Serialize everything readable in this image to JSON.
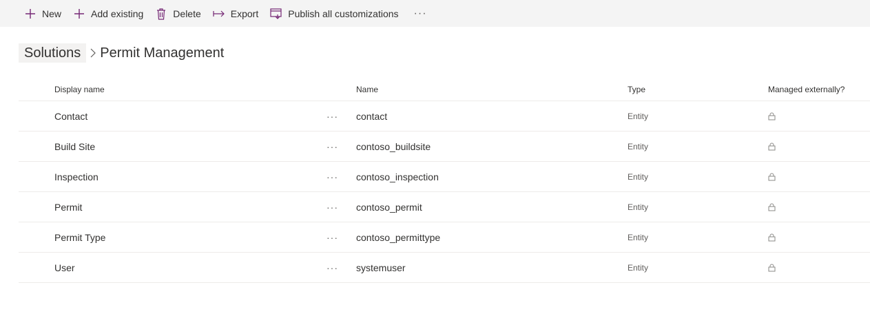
{
  "toolbar": {
    "new_label": "New",
    "add_existing_label": "Add existing",
    "delete_label": "Delete",
    "export_label": "Export",
    "publish_label": "Publish all customizations",
    "more_label": "···"
  },
  "breadcrumb": {
    "root": "Solutions",
    "current": "Permit Management"
  },
  "table": {
    "headers": {
      "display_name": "Display name",
      "name": "Name",
      "type": "Type",
      "managed": "Managed externally?"
    },
    "rows": [
      {
        "display": "Contact",
        "name": "contact",
        "type": "Entity"
      },
      {
        "display": "Build Site",
        "name": "contoso_buildsite",
        "type": "Entity"
      },
      {
        "display": "Inspection",
        "name": "contoso_inspection",
        "type": "Entity"
      },
      {
        "display": "Permit",
        "name": "contoso_permit",
        "type": "Entity"
      },
      {
        "display": "Permit Type",
        "name": "contoso_permittype",
        "type": "Entity"
      },
      {
        "display": "User",
        "name": "systemuser",
        "type": "Entity"
      }
    ],
    "row_more_label": "···"
  },
  "colors": {
    "accent": "#742774",
    "toolbar_bg": "#f4f4f4",
    "text": "#323130",
    "muted": "#605e5c"
  },
  "icons": [
    "plus-icon",
    "trash-icon",
    "export-arrow-icon",
    "publish-icon",
    "lock-icon"
  ]
}
